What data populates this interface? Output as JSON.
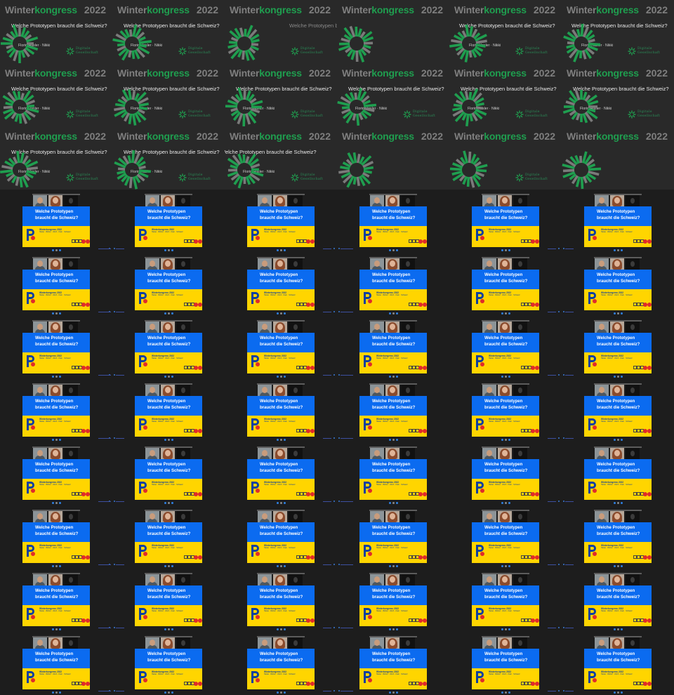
{
  "title_word_1": "Winter",
  "title_word_2": "kongress",
  "year": "2022",
  "question": "Welche Prototypen braucht die Schweiz?",
  "speakers": "Florin Hasler · Nikki",
  "brand": "Digitale Gesellschaft",
  "share_line_1": "Welche Prototypen",
  "share_line_2": "braucht die Schweiz?",
  "event_line": "Winterkongress 2022",
  "event_sub": "Hasler · Böhler · Ulrich · Klein · Schweiz",
  "colors": {
    "green": "#1f9e4f",
    "slide_bg": "#292929",
    "share_blue": "#0b6bf0",
    "share_yellow": "#ffd500",
    "leave_red": "#e02a2a"
  },
  "rows": [
    [
      "slide-a",
      "slide-a",
      "slide-q-only",
      "slide-burst",
      "slide-burst-q",
      "slide-burst-q"
    ],
    [
      "slide-full",
      "slide-full",
      "slide-full",
      "slide-full",
      "slide-full",
      "slide-full"
    ],
    [
      "slide-full",
      "slide-full",
      "slide-full-clip",
      "slide-burst",
      "slide-burst",
      "slide-burst"
    ],
    [
      "meet",
      "meet",
      "meet",
      "meet",
      "meet",
      "meet"
    ],
    [
      "meet",
      "meet",
      "meet",
      "meet",
      "meet",
      "meet"
    ],
    [
      "meet",
      "meet",
      "meet",
      "meet",
      "meet",
      "meet"
    ],
    [
      "meet",
      "meet",
      "meet",
      "meet",
      "meet",
      "meet"
    ],
    [
      "meet",
      "meet",
      "meet",
      "meet",
      "meet",
      "meet"
    ],
    [
      "meet",
      "meet",
      "meet",
      "meet",
      "meet",
      "meet"
    ],
    [
      "meet",
      "meet",
      "meet",
      "meet",
      "meet",
      "meet"
    ],
    [
      "meet",
      "meet",
      "meet",
      "meet",
      "meet",
      "meet"
    ]
  ]
}
